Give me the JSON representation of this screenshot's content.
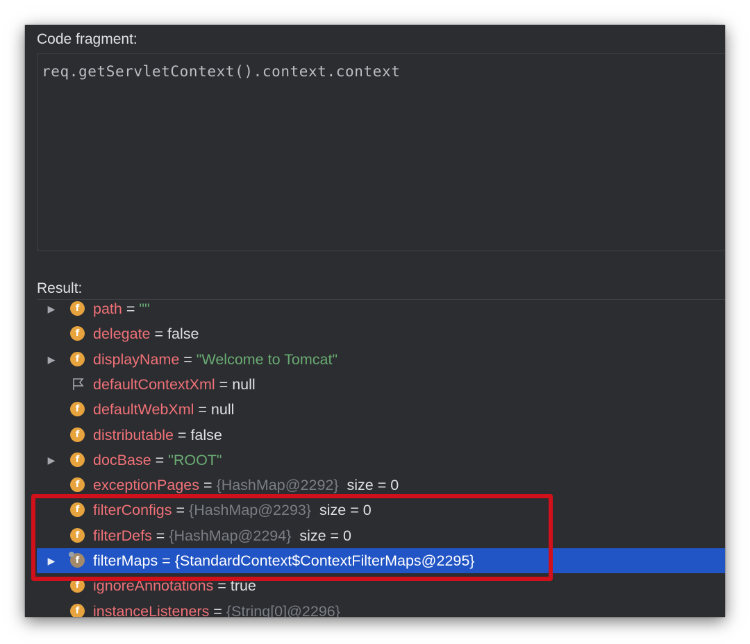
{
  "dialog": {
    "code_label": "Code fragment:",
    "code_text": "req.getServletContext().context.context",
    "result_label": "Result:"
  },
  "rows": [
    {
      "name": "path",
      "eq": " = ",
      "value": "\"\"",
      "value_style": "string",
      "arrow": true,
      "icon": "field-icon"
    },
    {
      "name": "delegate",
      "eq": " = ",
      "value": "false",
      "value_style": "plain",
      "arrow": false,
      "icon": "field-icon"
    },
    {
      "name": "displayName",
      "eq": " = ",
      "value": "\"Welcome to Tomcat\"",
      "value_style": "string",
      "arrow": true,
      "icon": "field-icon"
    },
    {
      "name": "defaultContextXml",
      "eq": " = ",
      "value": "null",
      "value_style": "plain",
      "arrow": false,
      "icon": "flag-icon"
    },
    {
      "name": "defaultWebXml",
      "eq": " = ",
      "value": "null",
      "value_style": "plain",
      "arrow": false,
      "icon": "field-icon"
    },
    {
      "name": "distributable",
      "eq": " = ",
      "value": "false",
      "value_style": "plain",
      "arrow": false,
      "icon": "field-icon"
    },
    {
      "name": "docBase",
      "eq": " = ",
      "value": "\"ROOT\"",
      "value_style": "string",
      "arrow": true,
      "icon": "field-icon"
    },
    {
      "name": "exceptionPages",
      "eq": " = ",
      "value": "{HashMap@2292}",
      "value_style": "ref",
      "suffix": "  size = 0",
      "arrow": false,
      "icon": "field-icon"
    },
    {
      "name": "filterConfigs",
      "eq": " = ",
      "value": "{HashMap@2293}",
      "value_style": "ref",
      "suffix": "  size = 0",
      "arrow": false,
      "icon": "field-icon"
    },
    {
      "name": "filterDefs",
      "eq": " = ",
      "value": "{HashMap@2294}",
      "value_style": "ref",
      "suffix": "  size = 0",
      "arrow": false,
      "icon": "field-icon"
    },
    {
      "name": "filterMaps",
      "eq": " = ",
      "value": "{StandardContext$ContextFilterMaps@2295}",
      "value_style": "plain",
      "arrow": true,
      "icon": "field-icon",
      "selected": true
    },
    {
      "name": "ignoreAnnotations",
      "eq": " = ",
      "value": "true",
      "value_style": "plain",
      "arrow": false,
      "icon": "field-icon"
    },
    {
      "name": "instanceListeners",
      "eq": " = ",
      "value": "{String[0]@2296}",
      "value_style": "ref",
      "arrow": false,
      "icon": "field-icon"
    }
  ],
  "icons": {
    "expand": "triangle-right-icon",
    "field": "f",
    "flag": "flag-icon"
  },
  "colors": {
    "background": "#2b2d30",
    "field_name": "#f07178",
    "string_value": "#6aab73",
    "reference_value": "#7a7e85",
    "selection": "#2154c4",
    "annotation_box": "#d0111b"
  }
}
